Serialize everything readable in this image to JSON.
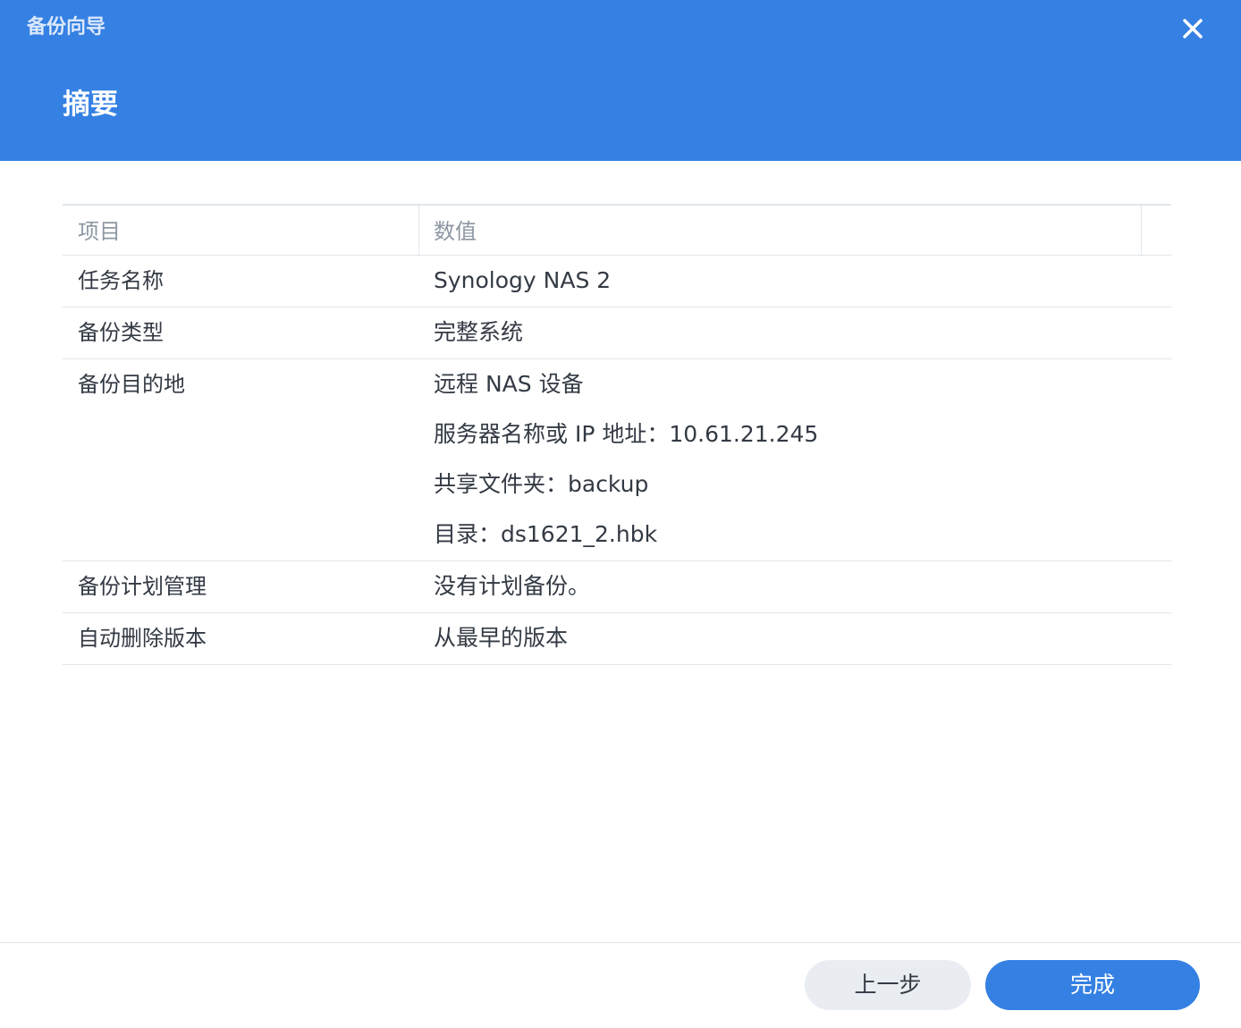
{
  "window": {
    "title": "备份向导",
    "close_icon": "close-icon"
  },
  "header": {
    "title": "摘要"
  },
  "table": {
    "columns": [
      "项目",
      "数值"
    ],
    "rows": [
      {
        "key": "任务名称",
        "values": [
          "Synology NAS 2"
        ]
      },
      {
        "key": "备份类型",
        "values": [
          "完整系统"
        ]
      },
      {
        "key": "备份目的地",
        "values": [
          "远程 NAS 设备",
          "服务器名称或 IP 地址：10.61.21.245",
          "共享文件夹：backup",
          "目录：ds1621_2.hbk"
        ]
      },
      {
        "key": "备份计划管理",
        "values": [
          "没有计划备份。"
        ]
      },
      {
        "key": "自动删除版本",
        "values": [
          "从最早的版本"
        ]
      }
    ]
  },
  "footer": {
    "back_label": "上一步",
    "finish_label": "完成"
  },
  "colors": {
    "header_bg": "#3580e3",
    "primary_button": "#3580e3",
    "secondary_button": "#e9edf2",
    "text": "#333a44",
    "muted_text": "#8d97a3",
    "border": "#e1e6ec"
  }
}
